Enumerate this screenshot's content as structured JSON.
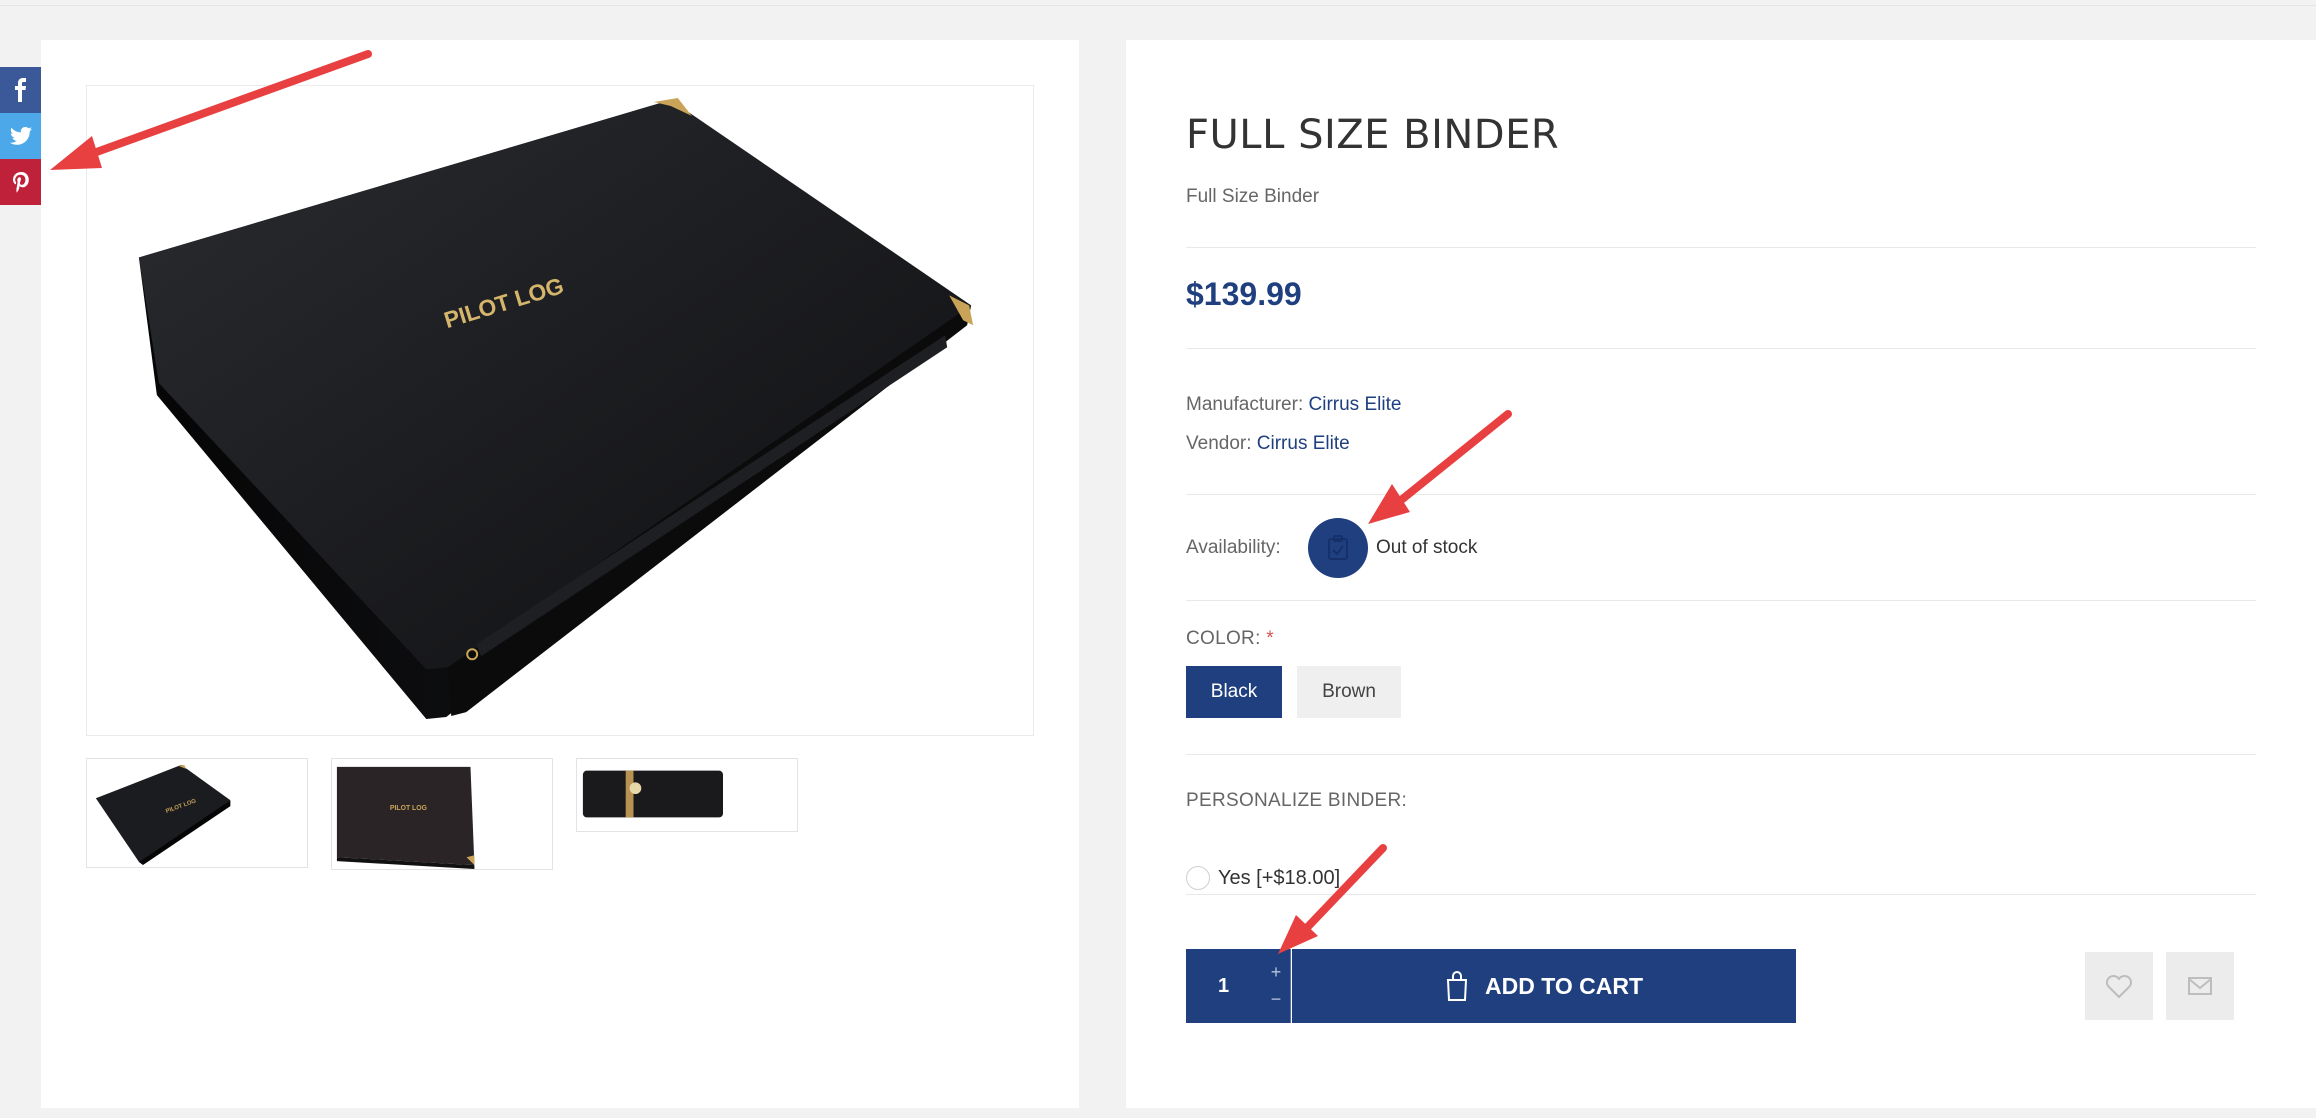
{
  "social": {
    "facebook_icon": "facebook-icon",
    "twitter_icon": "twitter-icon",
    "pinterest_icon": "pinterest-icon"
  },
  "gallery": {
    "main_cover_text": "PILOT LOG",
    "thumbnails": [
      "thumbnail-1",
      "thumbnail-2",
      "thumbnail-3"
    ]
  },
  "product": {
    "title": "FULL SIZE BINDER",
    "short_description": "Full Size Binder",
    "price": "$139.99",
    "manufacturer_label": "Manufacturer:",
    "manufacturer": "Cirrus Elite",
    "vendor_label": "Vendor:",
    "vendor": "Cirrus Elite",
    "availability_label": "Availability:",
    "availability": "Out of stock"
  },
  "options": {
    "color_label": "COLOR:",
    "required_mark": "*",
    "colors": [
      "Black",
      "Brown"
    ],
    "selected_color": "Black",
    "personalize_label": "PERSONALIZE BINDER:",
    "personalize_option": "Yes [+$18.00]"
  },
  "cart": {
    "quantity": "1",
    "plus": "+",
    "minus": "−",
    "add_to_cart": "ADD TO CART"
  },
  "colors": {
    "brand": "#1f3f7f",
    "facebook": "#3b5998",
    "twitter": "#4ca8e8",
    "pinterest": "#c0213a",
    "annotation": "#e84040"
  }
}
